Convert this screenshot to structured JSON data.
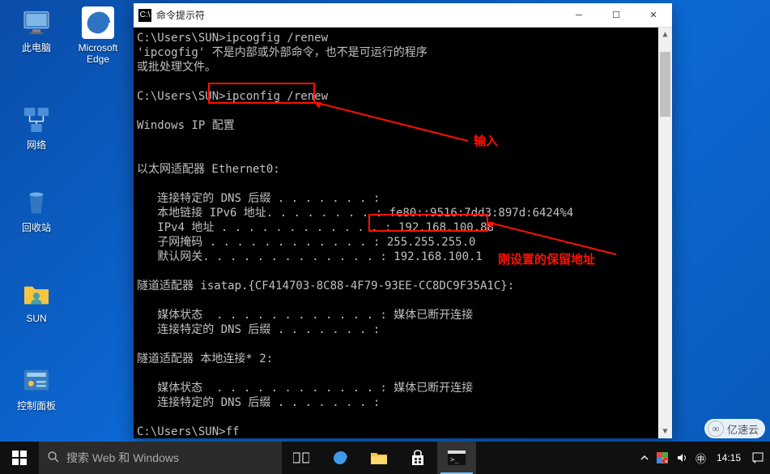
{
  "desktop_icons": {
    "this_pc": "此电脑",
    "edge": "Microsoft Edge",
    "network": "网络",
    "recycle_bin": "回收站",
    "sun": "SUN",
    "control_panel": "控制面板"
  },
  "cmd": {
    "title": "命令提示符",
    "icon_text": "C:\\",
    "lines": {
      "l1": "C:\\Users\\SUN>ipcogfig /renew",
      "l2": "'ipcogfig' 不是内部或外部命令，也不是可运行的程序",
      "l3": "或批处理文件。",
      "l5_prompt": "C:\\Users\\SUN>",
      "l5_cmd": "ipconfig /renew",
      "l7": "Windows IP 配置",
      "l9": "以太网适配器 Ethernet0:",
      "l11": "   连接特定的 DNS 后缀 . . . . . . . :",
      "l12": "   本地链接 IPv6 地址. . . . . . . . : fe80::9516:7dd3:897d:6424%4",
      "l13a": "   IPv4 地址 . . . . . . . . . . . . ",
      "l13b": ": 192.168.100.88",
      "l14": "   子网掩码 . . . . . . . . . . . . : 255.255.255.0",
      "l15": "   默认网关. . . . . . . . . . . . . : 192.168.100.1",
      "l17": "隧道适配器 isatap.{CF414703-8C88-4F79-93EE-CC8DC9F35A1C}:",
      "l19": "   媒体状态  . . . . . . . . . . . . : 媒体已断开连接",
      "l20": "   连接特定的 DNS 后缀 . . . . . . . :",
      "l22": "隧道适配器 本地连接* 2:",
      "l24": "   媒体状态  . . . . . . . . . . . . : 媒体已断开连接",
      "l25": "   连接特定的 DNS 后缀 . . . . . . . :",
      "l27": "C:\\Users\\SUN>ff"
    }
  },
  "annotations": {
    "input_label": "输入",
    "reserved_label": "刚设置的保留地址"
  },
  "taskbar": {
    "search_placeholder": "搜索 Web 和 Windows"
  },
  "tray": {
    "clock": "14:15"
  },
  "watermark": "亿速云"
}
